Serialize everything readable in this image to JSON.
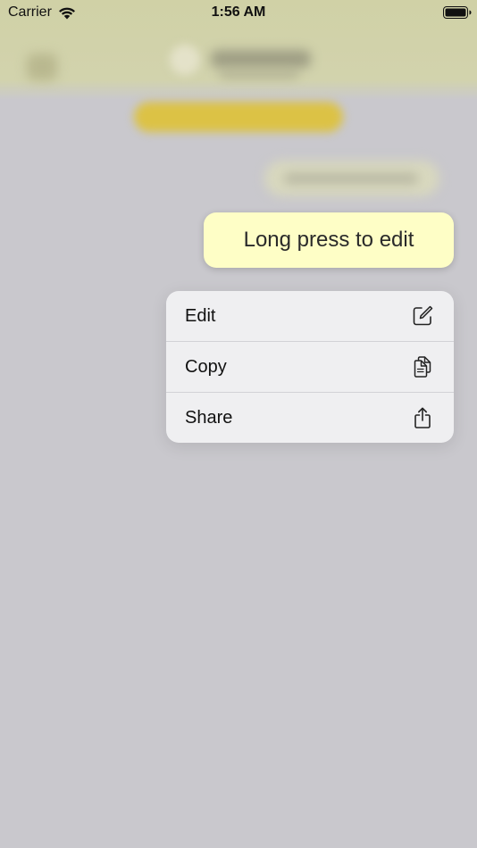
{
  "status_bar": {
    "carrier": "Carrier",
    "time": "1:56 AM"
  },
  "message": {
    "text": "Long press to edit",
    "bubble_color": "#fefec6"
  },
  "context_menu": {
    "items": [
      {
        "label": "Edit",
        "icon": "compose-icon"
      },
      {
        "label": "Copy",
        "icon": "copy-icon"
      },
      {
        "label": "Share",
        "icon": "share-icon"
      }
    ]
  },
  "colors": {
    "background_dim": "#c9c8cd",
    "nav_bar": "#d0d1a6",
    "menu_background": "#efeff1",
    "accent_yellow": "#dcc245"
  }
}
